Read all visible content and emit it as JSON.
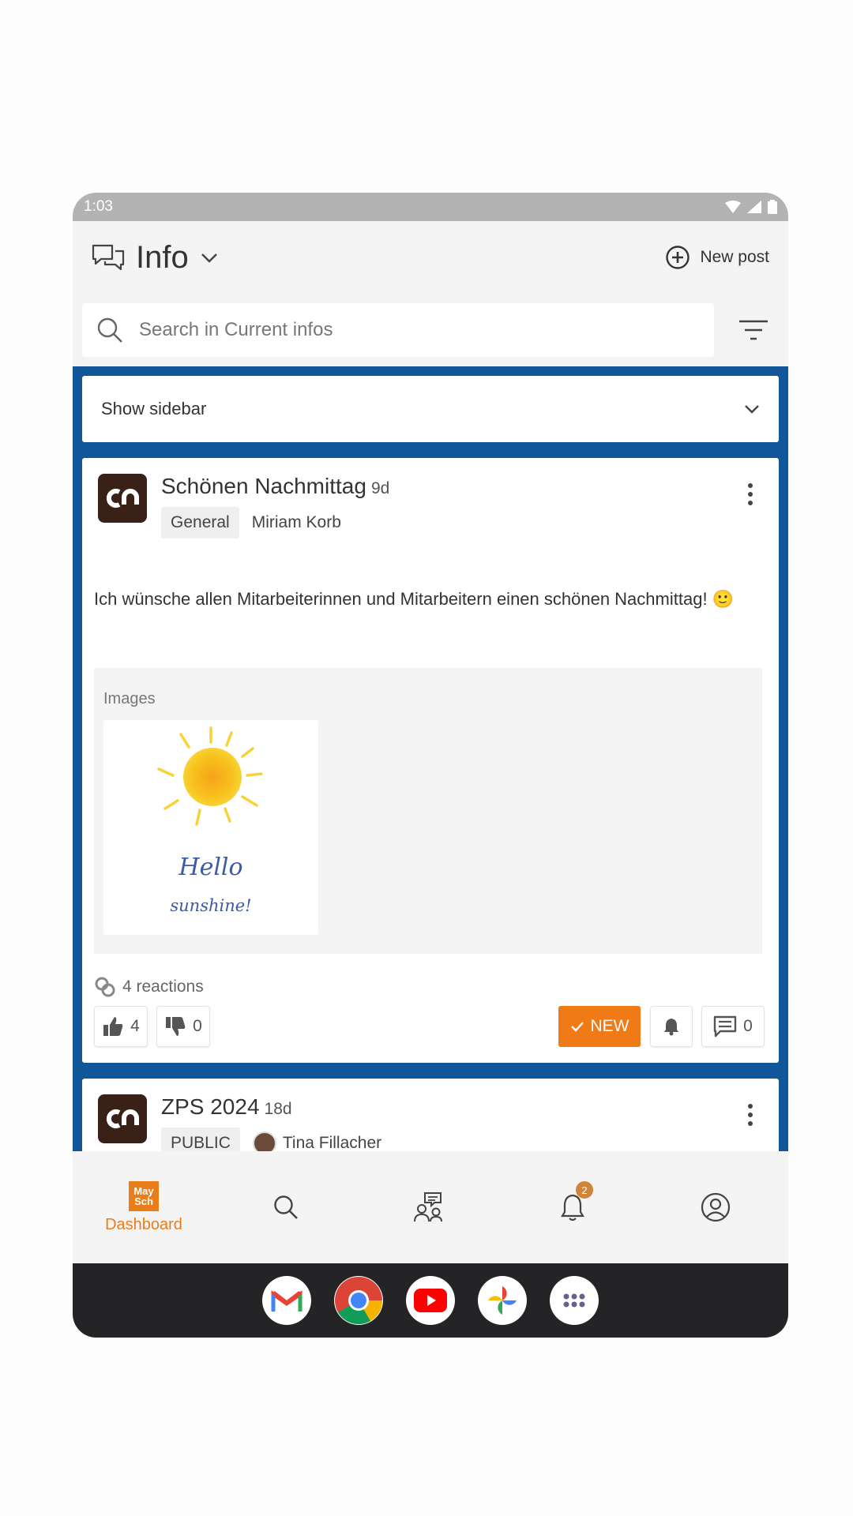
{
  "status_bar": {
    "time": "1:03"
  },
  "header": {
    "title": "Info",
    "new_post_label": "New post"
  },
  "search": {
    "placeholder": "Search in Current infos"
  },
  "sidebar_toggle": {
    "label": "Show sidebar"
  },
  "posts": [
    {
      "title": "Schönen Nachmittag",
      "age": "9d",
      "tag": "General",
      "author": "Miriam Korb",
      "body": "Ich wünsche allen Mitarbeiterinnen und Mitarbeitern einen schönen Nachmittag! 🙂",
      "images_label": "Images",
      "image_caption_1": "Hello",
      "image_caption_2": "sunshine!",
      "reactions": "4 reactions",
      "likes": "4",
      "dislikes": "0",
      "new_label": "NEW",
      "comments": "0"
    },
    {
      "title": "ZPS 2024",
      "age": "18d",
      "tag": "PUBLIC",
      "author": "Tina Fillacher"
    }
  ],
  "bottom_nav": {
    "dashboard_label": "Dashboard",
    "dashboard_logo_top": "May",
    "dashboard_logo_bottom": "Sch",
    "notification_count": "2"
  },
  "colors": {
    "accent": "#f07a16",
    "feed_background": "#12569a",
    "dock": "#242426"
  },
  "dock_apps": [
    "gmail-icon",
    "chrome-icon",
    "youtube-icon",
    "photos-icon",
    "app-drawer-icon"
  ]
}
